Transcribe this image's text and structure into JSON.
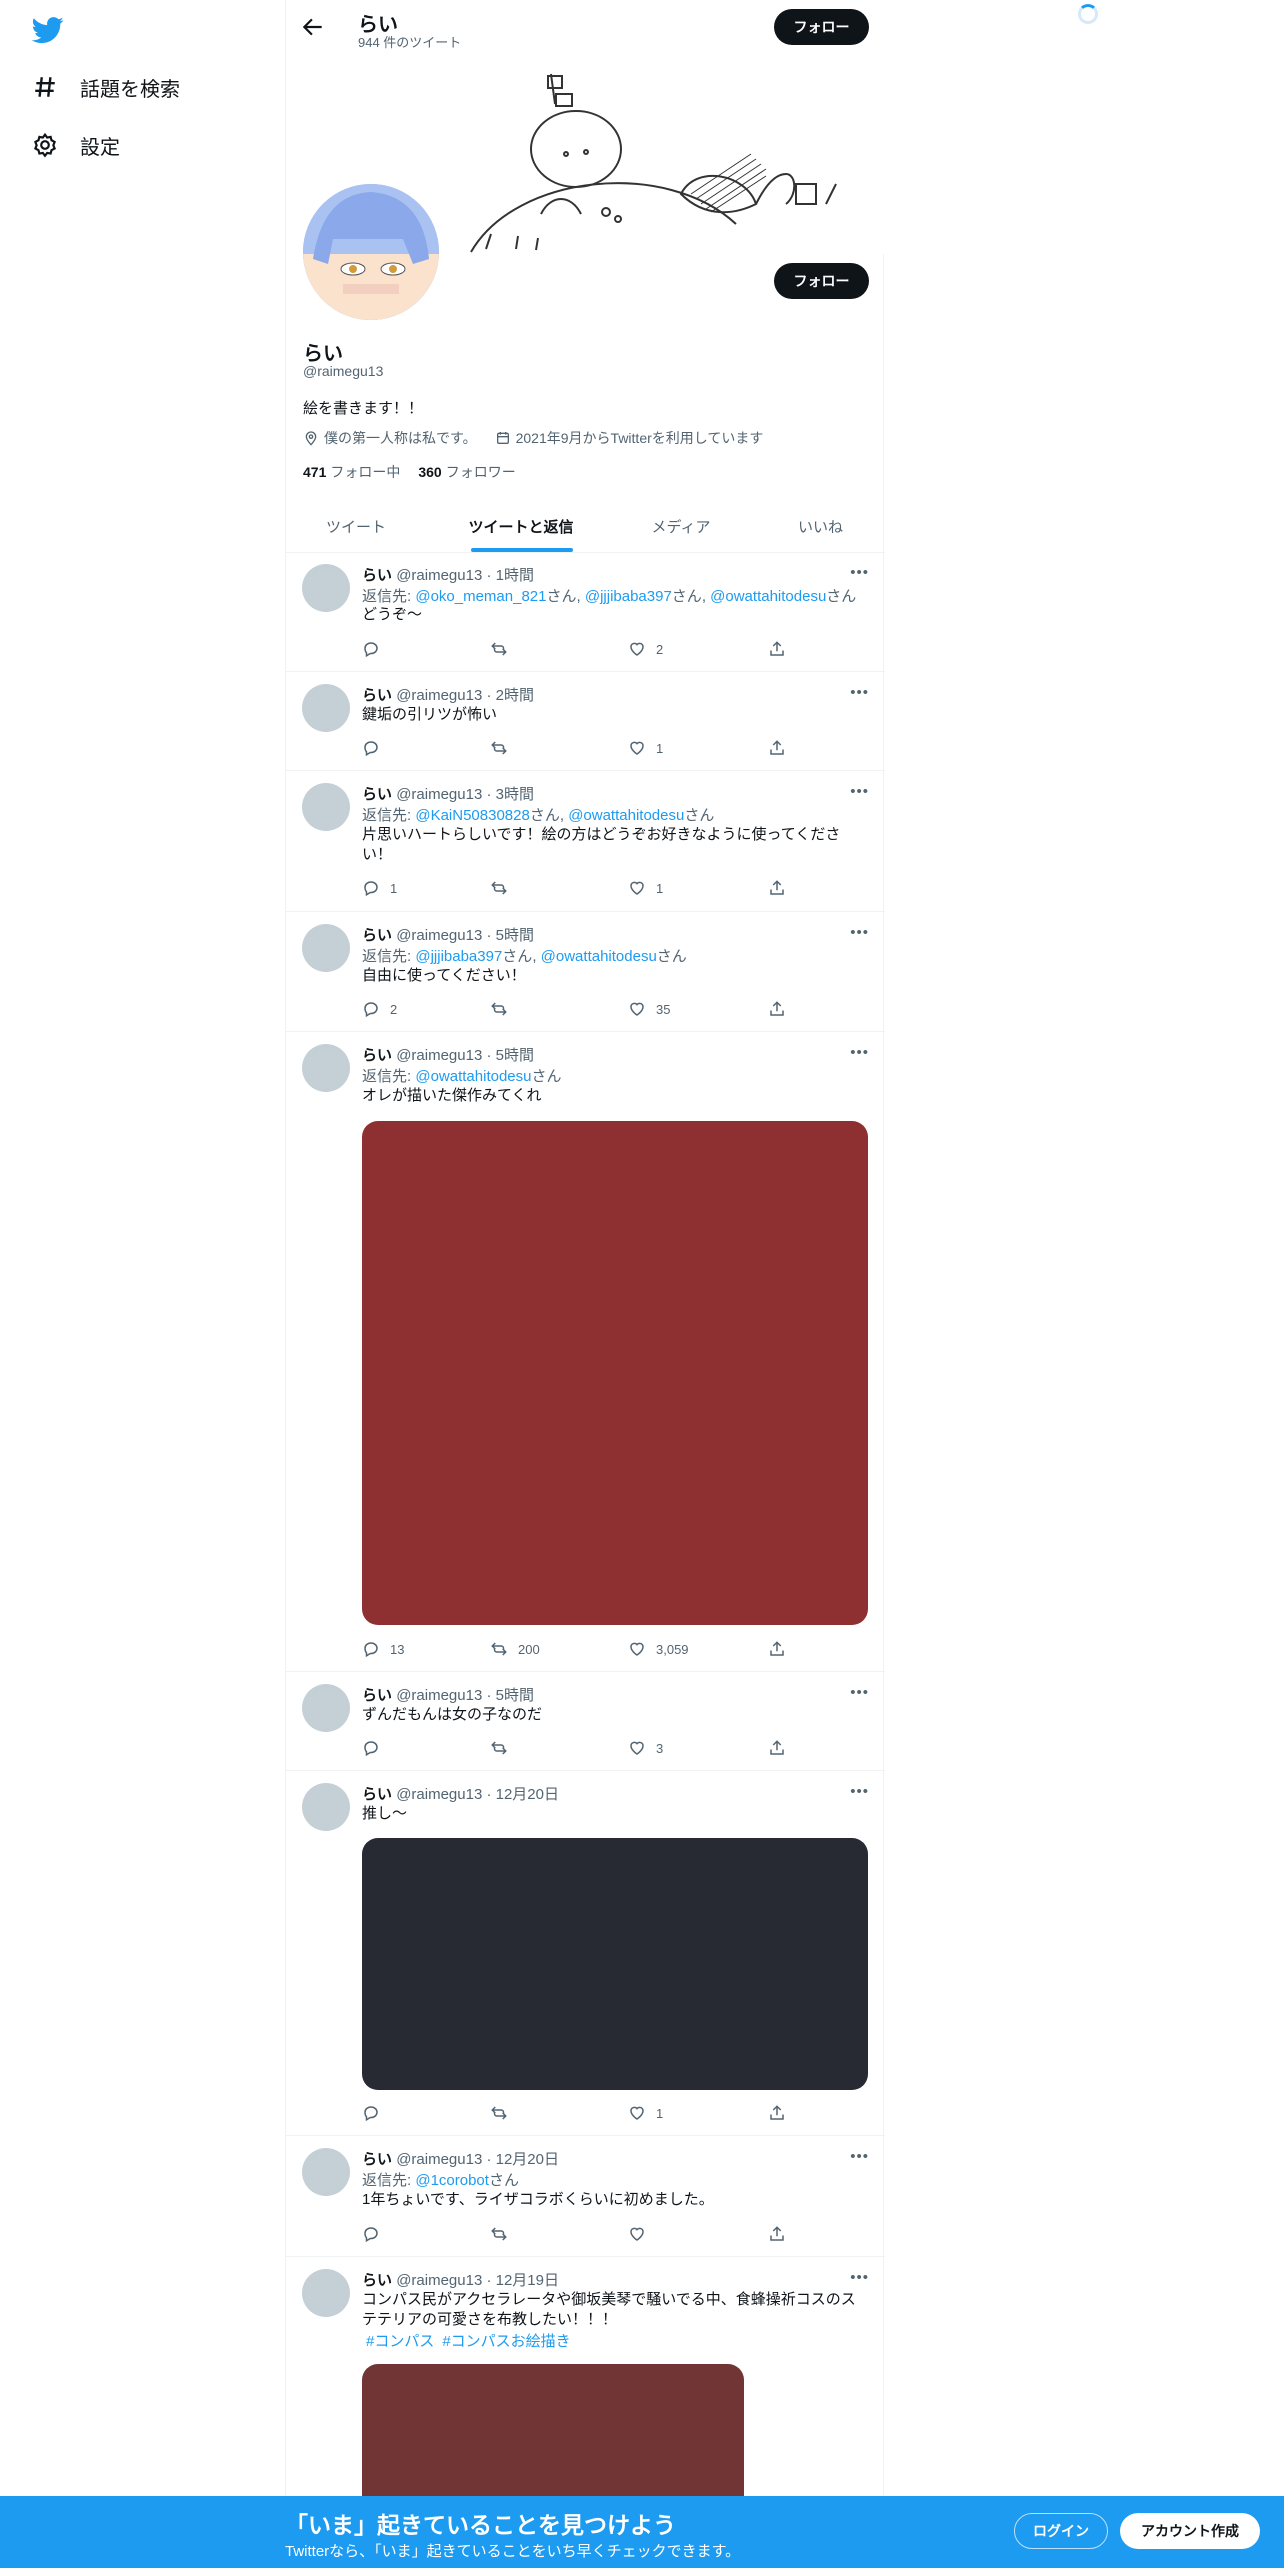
{
  "nav": {
    "search_label": "話題を検索",
    "settings_label": "設定"
  },
  "header": {
    "title": "らい",
    "subtitle": "944 件のツイート",
    "follow_label": "フォロー"
  },
  "profile": {
    "name": "らい",
    "handle": "@raimegu13",
    "bio": "絵を書きます！！",
    "location": "僕の第一人称は私です。",
    "joined": "2021年9月からTwitterを利用しています",
    "following_count": "471",
    "following_label": "フォロー中",
    "followers_count": "360",
    "followers_label": "フォロワー",
    "follow_label": "フォロー"
  },
  "tabs": [
    "ツイート",
    "ツイートと返信",
    "メディア",
    "いいね"
  ],
  "tweets": [
    {
      "name": "らい",
      "meta": "@raimegu13 · 1時間",
      "reply_prefix": "返信先: ",
      "mentions": [
        "@oko_meman_821",
        "@jjjibaba397",
        "@owattahitodesu"
      ],
      "text": "どうぞ〜",
      "replies": "",
      "retweets": "",
      "likes": "2"
    },
    {
      "name": "らい",
      "meta": "@raimegu13 · 2時間",
      "text": "鍵垢の引リツが怖い",
      "replies": "",
      "retweets": "",
      "likes": "1"
    },
    {
      "name": "らい",
      "meta": "@raimegu13 · 3時間",
      "reply_prefix": "返信先: ",
      "mentions": [
        "@KaiN50830828",
        "@owattahitodesu"
      ],
      "text": "片思いハートらしいです！絵の方はどうぞお好きなように使ってください！",
      "replies": "1",
      "retweets": "",
      "likes": "1"
    },
    {
      "name": "らい",
      "meta": "@raimegu13 · 5時間",
      "reply_prefix": "返信先: ",
      "mentions": [
        "@jjjibaba397",
        "@owattahitodesu"
      ],
      "text": "自由に使ってください！",
      "replies": "2",
      "retweets": "",
      "likes": "35"
    },
    {
      "name": "らい",
      "meta": "@raimegu13 · 5時間",
      "reply_prefix": "返信先: ",
      "mentions": [
        "@owattahitodesu"
      ],
      "text": "オレが描いた傑作みてくれ",
      "replies": "13",
      "retweets": "200",
      "likes": "3,059",
      "media_color": "#8e3031"
    },
    {
      "name": "らい",
      "meta": "@raimegu13 · 5時間",
      "text": "ずんだもんは女の子なのだ",
      "replies": "",
      "retweets": "",
      "likes": "3"
    },
    {
      "name": "らい",
      "meta": "@raimegu13 · 12月20日",
      "text": "推し〜",
      "replies": "",
      "retweets": "",
      "likes": "1",
      "media_color": "#272a33"
    },
    {
      "name": "らい",
      "meta": "@raimegu13 · 12月20日",
      "reply_prefix": "返信先: ",
      "mentions": [
        "@1corobot"
      ],
      "text": "1年ちょいです、ライザコラボくらいに初めました。",
      "replies": "",
      "retweets": "",
      "likes": ""
    },
    {
      "name": "らい",
      "meta": "@raimegu13 · 12月19日",
      "text": "コンパス民がアクセラレータや御坂美琴で騒いでる中、食蜂操祈コスのステテリアの可愛さを布教したい！！！",
      "hashtags": [
        "#コンパス",
        "#コンパスお絵描き"
      ],
      "media_color": "#723536"
    }
  ],
  "mention_suffix": "さん",
  "bottom": {
    "title": "「いま」起きていることを見つけよう",
    "subtitle": "Twitterなら、「いま」起きていることをいち早くチェックできます。",
    "login_label": "ログイン",
    "signup_label": "アカウント作成"
  },
  "colors": {
    "accent": "#1d9bf0",
    "text": "#0f1419",
    "muted": "#536471",
    "bottom_bar": "#1d9bf0"
  }
}
